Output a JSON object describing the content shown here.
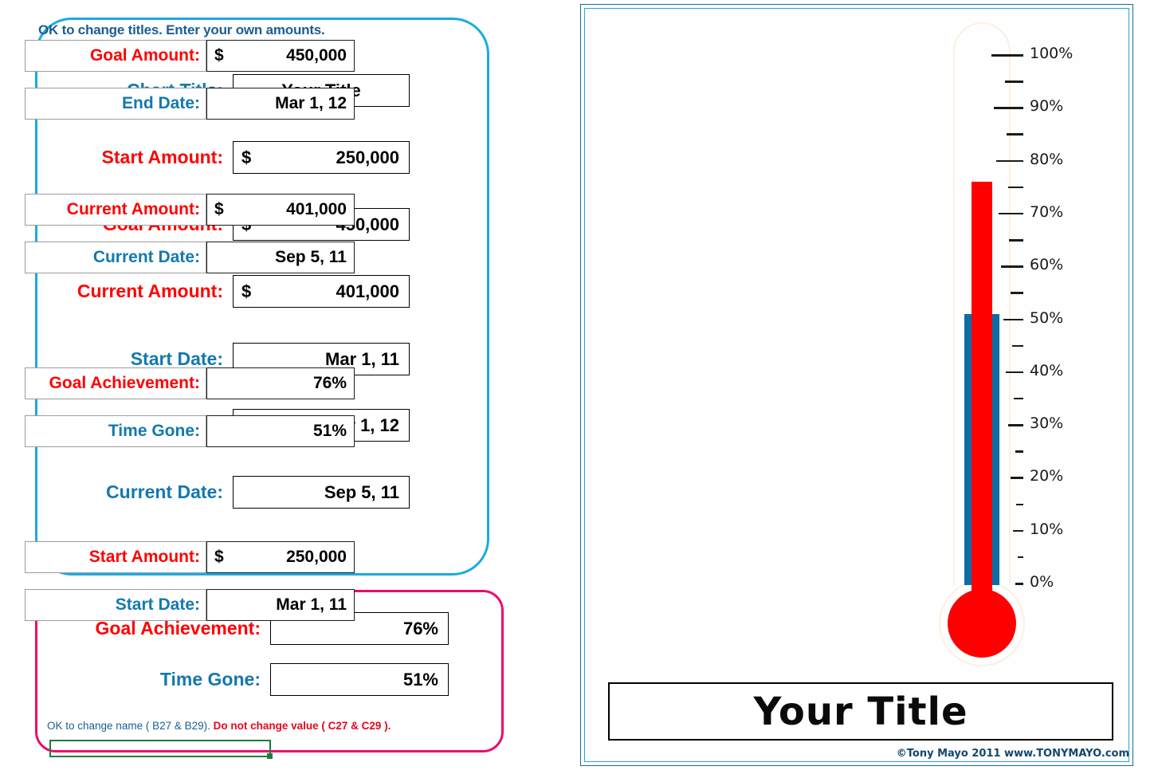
{
  "input_panel": {
    "hint": "OK to change titles. Enter your own amounts.",
    "border_color": "#19ABE2",
    "fields": [
      {
        "label": "Chart Title:",
        "label_color": "blue",
        "type": "text",
        "value": "Your Title",
        "currency": ""
      },
      {
        "label": "Start Amount:",
        "label_color": "red",
        "type": "currency",
        "value": "250,000",
        "currency": "$"
      },
      {
        "label": "Goal Amount:",
        "label_color": "red",
        "type": "currency",
        "value": "450,000",
        "currency": "$"
      },
      {
        "label": "Current Amount:",
        "label_color": "red",
        "type": "currency",
        "value": "401,000",
        "currency": "$"
      },
      {
        "label": "Start Date:",
        "label_color": "blue",
        "type": "right",
        "value": "Mar 1, 11",
        "currency": ""
      },
      {
        "label": "End Date:",
        "label_color": "blue",
        "type": "right",
        "value": "Mar 1, 12",
        "currency": ""
      },
      {
        "label": "Current Date:",
        "label_color": "blue",
        "type": "right",
        "value": "Sep 5, 11",
        "currency": ""
      }
    ]
  },
  "results_panel": {
    "border_color": "#EC0A6E",
    "rows": [
      {
        "label": "Goal Achievement:",
        "label_color": "red",
        "value": "76%"
      },
      {
        "label": "Time Gone:",
        "label_color": "blue",
        "value": "51%"
      }
    ],
    "note_ok": "OK to change name ( B27 & B29).",
    "note_warn": "Do not change value ( C27 & C29 )."
  },
  "chart_panel": {
    "outer_border_color": "#1B6A93",
    "inner_border_color": "#2EA3D6",
    "rows": [
      {
        "label": "Goal Amount:",
        "label_color": "red",
        "type": "currency",
        "currency": "$",
        "value": "450,000"
      },
      {
        "label": "End Date:",
        "label_color": "blue",
        "type": "right",
        "currency": "",
        "value": "Mar 1, 12"
      },
      {
        "label": "Current Amount:",
        "label_color": "red",
        "type": "currency",
        "currency": "$",
        "value": "401,000"
      },
      {
        "label": "Current Date:",
        "label_color": "blue",
        "type": "right",
        "currency": "",
        "value": "Sep 5, 11"
      },
      {
        "label": "Goal Achievement:",
        "label_color": "red",
        "type": "right",
        "currency": "",
        "value": "76%"
      },
      {
        "label": "Time Gone:",
        "label_color": "blue",
        "type": "right",
        "currency": "",
        "value": "51%"
      },
      {
        "label": "Start Amount:",
        "label_color": "red",
        "type": "currency",
        "currency": "$",
        "value": "250,000"
      },
      {
        "label": "Start Date:",
        "label_color": "blue",
        "type": "right",
        "currency": "",
        "value": "Mar 1, 11"
      }
    ],
    "title": "Your Title",
    "copyright": "©Tony Mayo 2011 www.TONYMAYO.com"
  },
  "chart_data": {
    "type": "bar",
    "title": "Your Title",
    "orientation": "vertical",
    "subtype": "thermometer-gauge",
    "ylabel": "",
    "xlabel": "",
    "ylim": [
      0,
      100
    ],
    "tick_labels": [
      "0%",
      "10%",
      "20%",
      "30%",
      "40%",
      "50%",
      "60%",
      "70%",
      "80%",
      "90%",
      "100%"
    ],
    "tick_values": [
      0,
      10,
      20,
      30,
      40,
      50,
      60,
      70,
      80,
      90,
      100
    ],
    "minor_tick_values": [
      5,
      15,
      25,
      35,
      45,
      55,
      65,
      75,
      85,
      95
    ],
    "grid": false,
    "legend": "none",
    "categories": [
      "Goal Achievement",
      "Time Gone"
    ],
    "values": [
      76,
      51
    ],
    "series": [
      {
        "name": "Goal Achievement",
        "values": [
          76
        ],
        "color": "#FF0000"
      },
      {
        "name": "Time Gone",
        "values": [
          51
        ],
        "color": "#0B6DA4"
      }
    ],
    "annotations": {
      "start_amount": 250000,
      "goal_amount": 450000,
      "current_amount": 401000,
      "start_date": "Mar 1, 11",
      "end_date": "Mar 1, 12",
      "current_date": "Sep 5, 11"
    }
  }
}
